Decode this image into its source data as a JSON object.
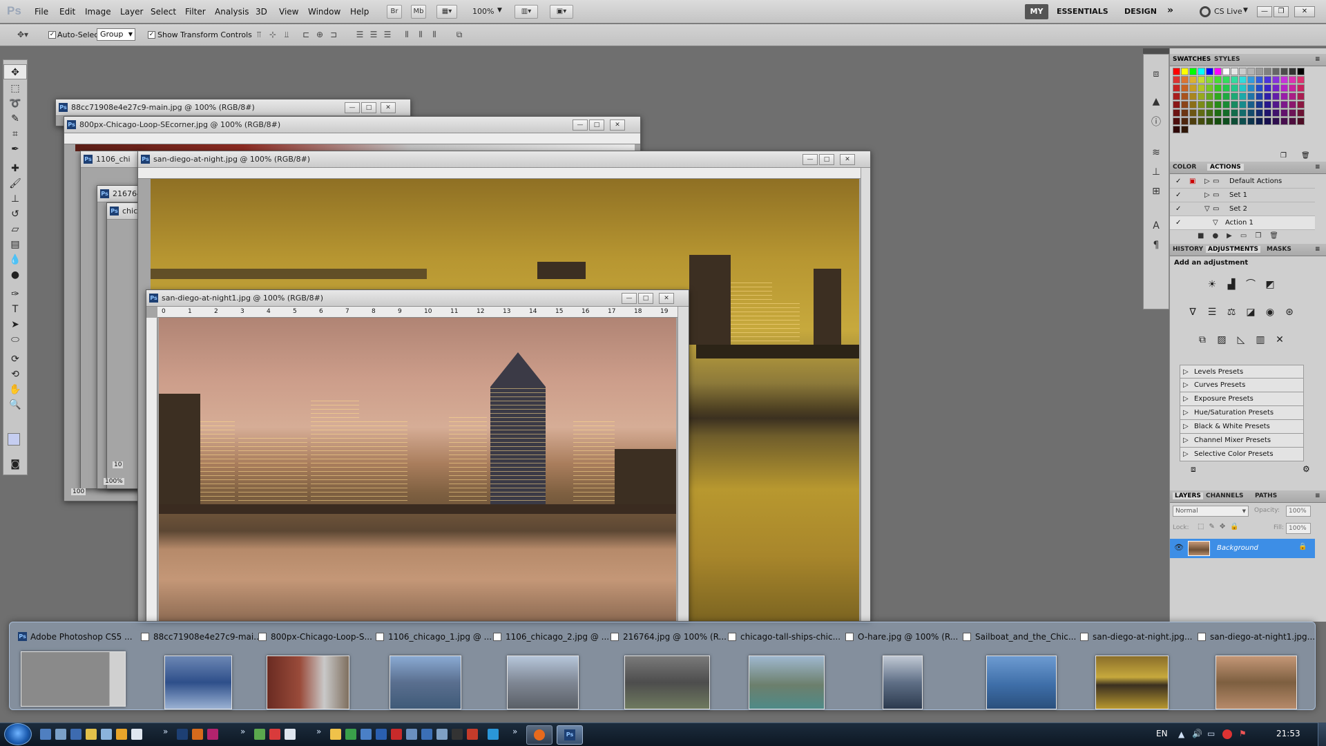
{
  "app": {
    "logo_text": "Ps"
  },
  "menu": [
    "File",
    "Edit",
    "Image",
    "Layer",
    "Select",
    "Filter",
    "Analysis",
    "3D",
    "View",
    "Window",
    "Help"
  ],
  "menubar": {
    "br_label": "Br",
    "mb_label": "Mb",
    "zoom": "100%"
  },
  "workspaces": {
    "my": "MY",
    "essentials": "ESSENTIALS",
    "design": "DESIGN",
    "more": "»",
    "cslive": "CS Live"
  },
  "options": {
    "auto_select_label": "Auto-Select:",
    "auto_select_value": "Group",
    "transform_label": "Show Transform Controls"
  },
  "documents": {
    "doc1": {
      "title": "88cc71908e4e27c9-main.jpg @ 100% (RGB/8#)"
    },
    "doc2": {
      "title": "800px-Chicago-Loop-SEcorner.jpg @ 100% (RGB/8#)"
    },
    "doc3": {
      "title": "1106_chi"
    },
    "doc4": {
      "title": "216764"
    },
    "doc5": {
      "title": "chic"
    },
    "doc6": {
      "title": "san-diego-at-night.jpg @ 100% (RGB/8#)"
    },
    "doc7": {
      "title": "san-diego-at-night1.jpg @ 100% (RGB/8#)"
    },
    "stack_zoom_a": "100",
    "stack_zoom_b": "100%",
    "stack_zoom_c": "10",
    "ruler_numbers": [
      "0",
      "1",
      "2",
      "3",
      "4",
      "5",
      "6",
      "7",
      "8",
      "9",
      "10",
      "11",
      "12",
      "13",
      "14",
      "15",
      "16",
      "17",
      "18",
      "19"
    ]
  },
  "panels": {
    "swatches_tab": "SWATCHES",
    "styles_tab": "STYLES",
    "color_tab": "COLOR",
    "actions_tab": "ACTIONS",
    "actions": [
      {
        "label": "Default Actions"
      },
      {
        "label": "Set 1"
      },
      {
        "label": "Set 2"
      },
      {
        "label": "Action 1"
      }
    ],
    "history_tab": "HISTORY",
    "adjustments_tab": "ADJUSTMENTS",
    "masks_tab": "MASKS",
    "add_adjustment": "Add an adjustment",
    "presets": [
      "Levels Presets",
      "Curves Presets",
      "Exposure Presets",
      "Hue/Saturation Presets",
      "Black & White Presets",
      "Channel Mixer Presets",
      "Selective Color Presets"
    ],
    "layers_tab": "LAYERS",
    "channels_tab": "CHANNELS",
    "paths_tab": "PATHS",
    "blend_mode": "Normal",
    "opacity_label": "Opacity:",
    "opacity_value": "100%",
    "lock_label": "Lock:",
    "fill_label": "Fill:",
    "fill_value": "100%",
    "layer_name": "Background"
  },
  "previews": [
    {
      "title": "Adobe Photoshop CS5 ..."
    },
    {
      "title": "88cc71908e4e27c9-mai..."
    },
    {
      "title": "800px-Chicago-Loop-S..."
    },
    {
      "title": "1106_chicago_1.jpg @ ..."
    },
    {
      "title": "1106_chicago_2.jpg @ ..."
    },
    {
      "title": "216764.jpg @ 100% (R..."
    },
    {
      "title": "chicago-tall-ships-chic..."
    },
    {
      "title": "O-hare.jpg @ 100% (R..."
    },
    {
      "title": "Sailboat_and_the_Chic..."
    },
    {
      "title": "san-diego-at-night.jpg..."
    },
    {
      "title": "san-diego-at-night1.jpg..."
    }
  ],
  "taskbar": {
    "lang": "EN",
    "clock": "21:53"
  },
  "colors": {
    "accent": "#2f7fd8",
    "selected_layer": "#3d8ee6"
  }
}
